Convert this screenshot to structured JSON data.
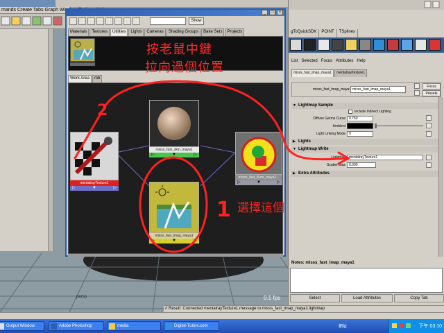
{
  "viewport": {
    "menubar_text": "mands  Create  Tabs  Graph  Window  Options  Help",
    "camera_label": "persp",
    "fps": "0.1 fps"
  },
  "hypershade": {
    "show_button": "Show",
    "top_tabs": [
      "Materials",
      "Textures",
      "Utilities",
      "Lights",
      "Cameras",
      "Shading Groups",
      "Bake Sets",
      "Projects"
    ],
    "top_tab_active": 2,
    "work_tabs": [
      "Work Area",
      "mb"
    ],
    "annotation_line1": "按老鼠中鍵",
    "annotation_line2": "拉向過個位置",
    "annotation_select": "選擇這個",
    "annotation_num1": "1",
    "annotation_num2": "2",
    "nodes": {
      "mentalray": {
        "label": "mentalrayTexture1",
        "ports": [
          "▷",
          "▼",
          "▷"
        ]
      },
      "skin": {
        "label": "misss_fast_skin_maya1",
        "ports": [
          "▷",
          "▼",
          "▷"
        ]
      },
      "fastlmap": {
        "label": "misss_fast_lmap_maya1",
        "ports": [
          "▷",
          "▼",
          "▷"
        ]
      },
      "mib": {
        "label": "misss_fast_illum_maya2...",
        "ports": [
          "▷",
          "▼",
          "▷"
        ]
      }
    }
  },
  "attr_editor": {
    "top_tabs": [
      "gToQuickSDK",
      "POINT",
      "TSplines"
    ],
    "menu": [
      "List",
      "Selected",
      "Focus",
      "Attributes",
      "Help"
    ],
    "node_tabs": [
      "misss_fast_lmap_maya1",
      "mentalrayTexture1"
    ],
    "type_label": "misss_fast_lmap_maya:",
    "type_value": "misss_fast_lmap_maya1",
    "focus_button": "Focus",
    "presets_button": "Presets",
    "sections": {
      "lightmap_sample": "Lightmap Sample",
      "lights": "Lights",
      "lightmap_write": "Lightmap Write",
      "extra": "Extra Attributes"
    },
    "include_indirect": "Include Indirect Lighting",
    "diffuse_label": "Diffuse Germs Curve",
    "diffuse_value": "0.750",
    "ambient_label": "Ambient",
    "linking_label": "Light Linking Mode",
    "linking_value": "0",
    "lightmap_label": "Lightmap",
    "lightmap_value": "mentalrayTexture1",
    "scatter_label": "Scatter Bias",
    "scatter_value": "0.000",
    "notes_label": "Notes:  misss_fast_lmap_maya1",
    "buttons": [
      "Select",
      "Load Attributes",
      "Copy Tab"
    ]
  },
  "cmdline": "// Result: Connected mentalrayTexture1.message to misss_fast_lmap_maya1.lightmap",
  "taskbar": {
    "items": [
      "Output Window",
      "Adobe Photoshop",
      "media",
      "Digital-Tutors.com"
    ],
    "lang": "網址",
    "time": "下午 03:10"
  },
  "colors": {
    "annotation_red": "#ff2020",
    "hypershade_bg": "#1e1e1e",
    "taskbar_blue": "#245edb"
  }
}
